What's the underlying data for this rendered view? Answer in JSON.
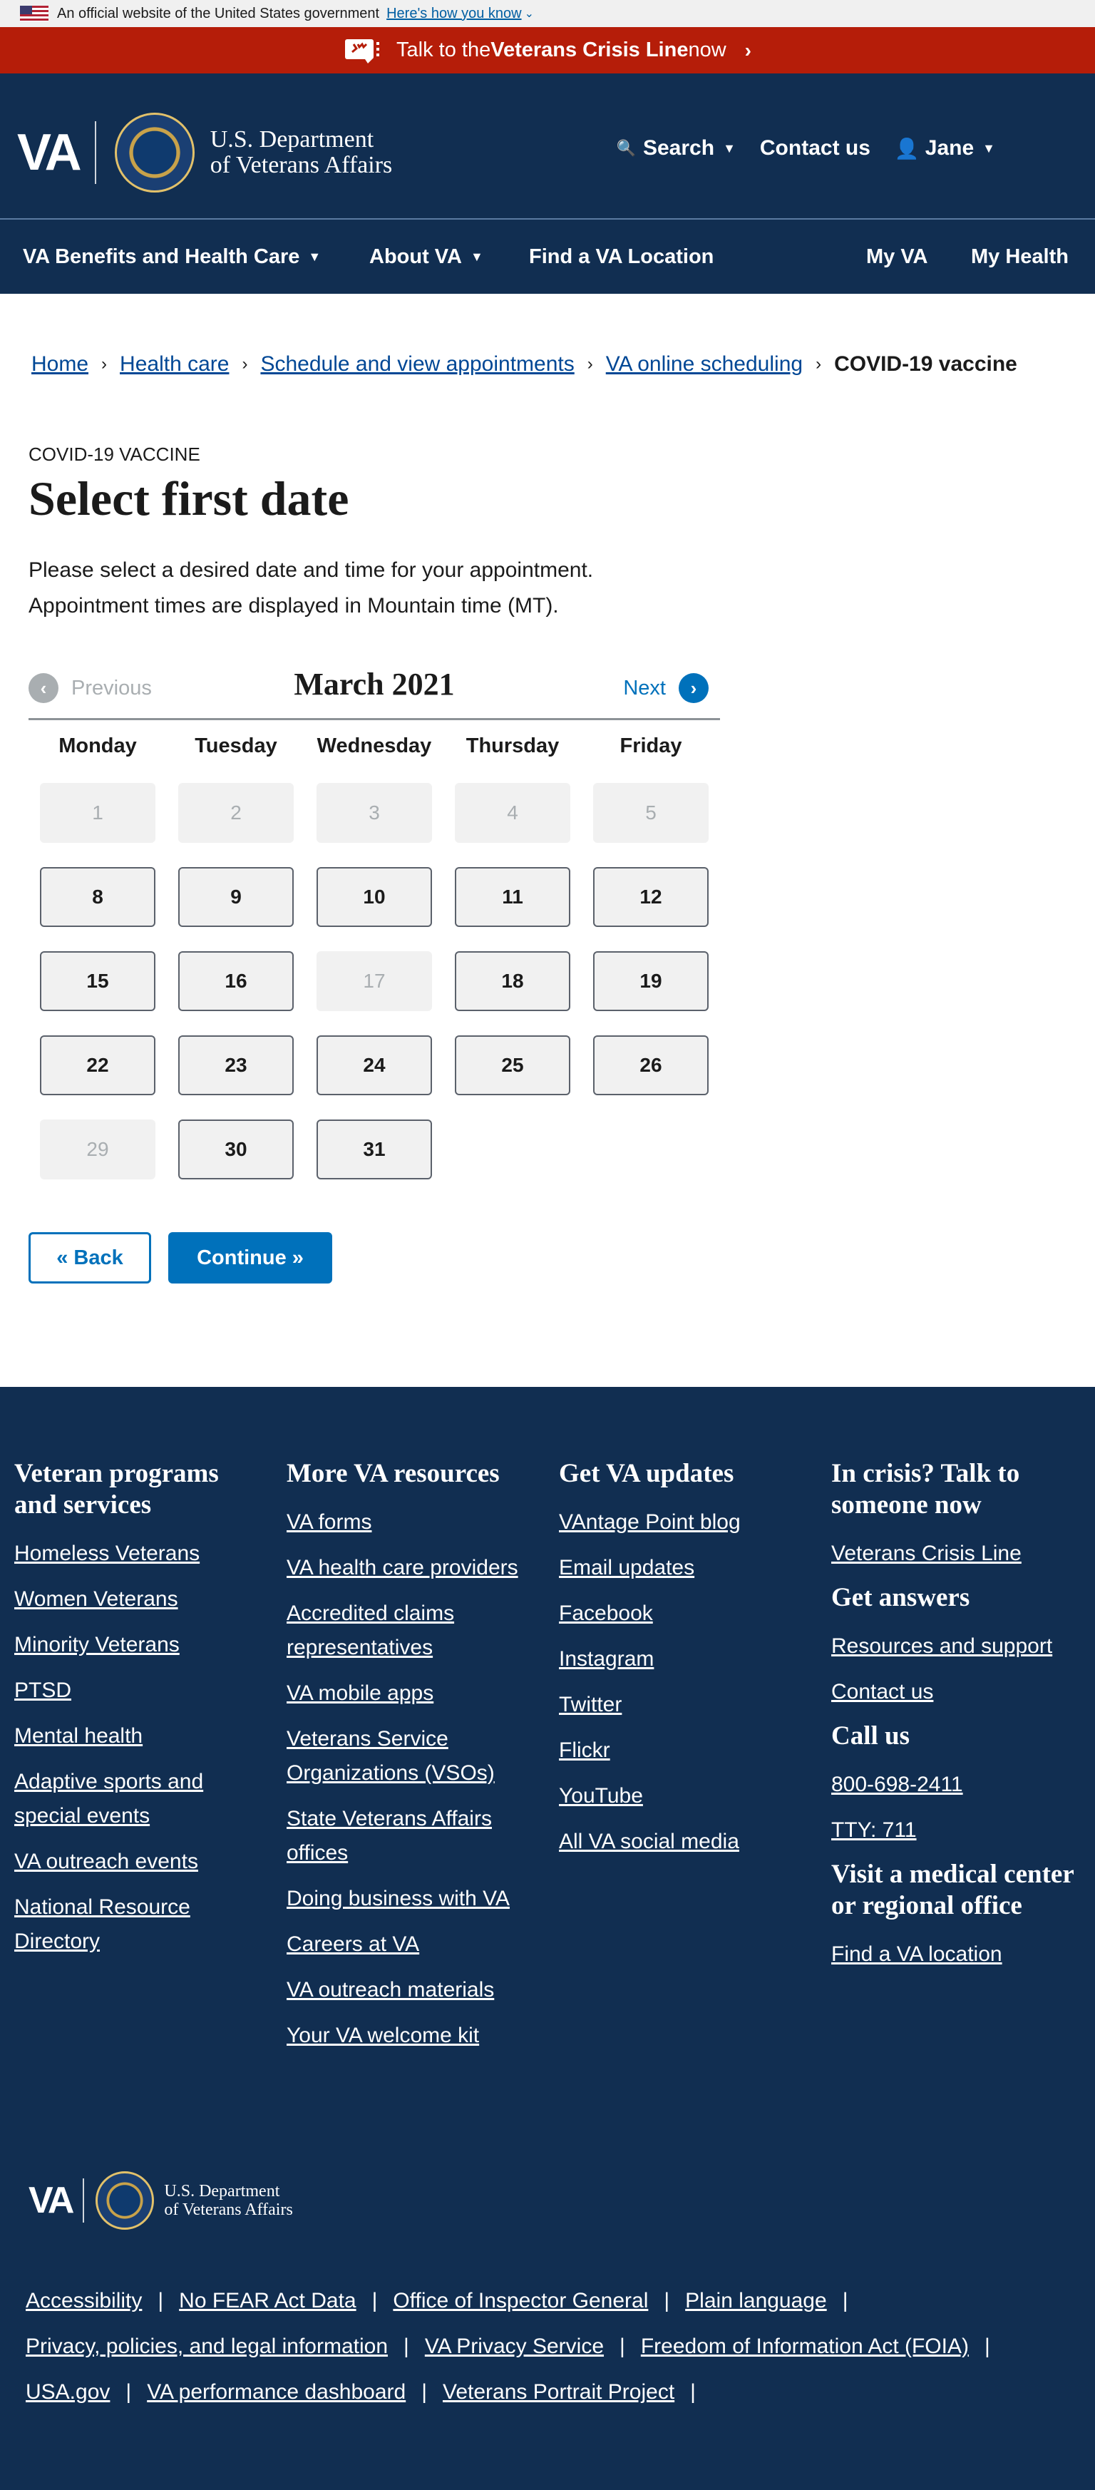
{
  "gov_banner": {
    "text": "An official website of the United States government",
    "link": "Here's how you know"
  },
  "crisis": {
    "prefix": "Talk to the ",
    "bold": "Veterans Crisis Line",
    "suffix": " now"
  },
  "header": {
    "logo_text": "VA",
    "dept_line1": "U.S. Department",
    "dept_line2": "of Veterans Affairs",
    "search": "Search",
    "contact": "Contact us",
    "user": "Jane"
  },
  "mainnav": {
    "benefits": "VA Benefits and Health Care",
    "about": "About VA",
    "find": "Find a VA Location",
    "myva": "My VA",
    "myhealth": "My Health"
  },
  "breadcrumb": [
    "Home",
    "Health care",
    "Schedule and view appointments",
    "VA online scheduling",
    "COVID-19 vaccine"
  ],
  "content": {
    "eyebrow": "COVID-19 vaccine",
    "title": "Select first date",
    "intro_line1": "Please select a desired date and time for your appointment.",
    "intro_line2": "Appointment times are displayed in Mountain time (MT)."
  },
  "calendar": {
    "prev": "Previous",
    "next": "Next",
    "month": "March 2021",
    "weekdays": [
      "Monday",
      "Tuesday",
      "Wednesday",
      "Thursday",
      "Friday"
    ],
    "days": [
      {
        "label": "1",
        "enabled": false
      },
      {
        "label": "2",
        "enabled": false
      },
      {
        "label": "3",
        "enabled": false
      },
      {
        "label": "4",
        "enabled": false
      },
      {
        "label": "5",
        "enabled": false
      },
      {
        "label": "8",
        "enabled": true
      },
      {
        "label": "9",
        "enabled": true
      },
      {
        "label": "10",
        "enabled": true
      },
      {
        "label": "11",
        "enabled": true
      },
      {
        "label": "12",
        "enabled": true
      },
      {
        "label": "15",
        "enabled": true
      },
      {
        "label": "16",
        "enabled": true
      },
      {
        "label": "17",
        "enabled": false
      },
      {
        "label": "18",
        "enabled": true
      },
      {
        "label": "19",
        "enabled": true
      },
      {
        "label": "22",
        "enabled": true
      },
      {
        "label": "23",
        "enabled": true
      },
      {
        "label": "24",
        "enabled": true
      },
      {
        "label": "25",
        "enabled": true
      },
      {
        "label": "26",
        "enabled": true
      },
      {
        "label": "29",
        "enabled": false
      },
      {
        "label": "30",
        "enabled": true
      },
      {
        "label": "31",
        "enabled": true
      }
    ]
  },
  "buttons": {
    "back": "« Back",
    "continue": "Continue »"
  },
  "footer": {
    "col1": {
      "title": "Veteran programs and services",
      "links": [
        "Homeless Veterans",
        "Women Veterans",
        "Minority Veterans",
        "PTSD",
        "Mental health",
        "Adaptive sports and special events",
        "VA outreach events",
        "National Resource Directory"
      ]
    },
    "col2": {
      "title": "More VA resources",
      "links": [
        "VA forms",
        "VA health care providers",
        "Accredited claims representatives",
        "VA mobile apps",
        "Veterans Service Organizations (VSOs)",
        "State Veterans Affairs offices",
        "Doing business with VA",
        "Careers at VA",
        "VA outreach materials",
        "Your VA welcome kit"
      ]
    },
    "col3": {
      "title": "Get VA updates",
      "links": [
        "VAntage Point blog",
        "Email updates",
        "Facebook",
        "Instagram",
        "Twitter",
        "Flickr",
        "YouTube",
        "All VA social media"
      ]
    },
    "col4": {
      "crisis_title": "In crisis? Talk to someone now",
      "crisis_link": "Veterans Crisis Line",
      "answers_title": "Get answers",
      "answers_links": [
        "Resources and support",
        "Contact us"
      ],
      "call_title": "Call us",
      "call_links": [
        "800-698-2411",
        "TTY: 711"
      ],
      "visit_title": "Visit a medical center or regional office",
      "visit_link": "Find a VA location"
    },
    "legal_row1": [
      "Accessibility",
      "No FEAR Act Data",
      "Office of Inspector General",
      "Plain language"
    ],
    "legal_row2": [
      "Privacy, policies, and legal information",
      "VA Privacy Service",
      "Freedom of Information Act (FOIA)"
    ],
    "legal_row3": [
      "USA.gov",
      "VA performance dashboard",
      "Veterans Portrait Project"
    ]
  }
}
